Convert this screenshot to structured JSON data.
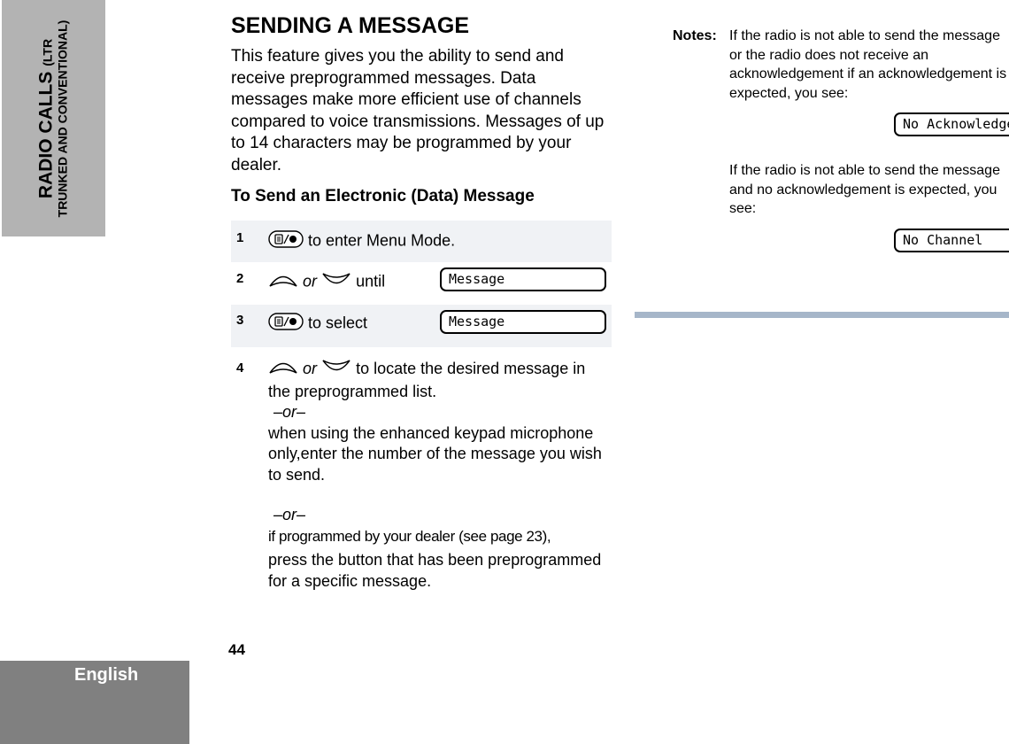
{
  "side_tab": {
    "line1_main": "RADIO CALLS",
    "line1_small": "(LTR",
    "line2": "TRUNKED AND CONVENTIONAL)"
  },
  "language_tab": "English",
  "page_number": "44",
  "section": {
    "title": "SENDING A MESSAGE",
    "intro": "This feature gives you the ability to send and receive preprogrammed messages. Data messages make more efficient use of channels compared to voice transmissions. Messages of up to 14 characters may be programmed by your dealer.",
    "subheading": "To Send an Electronic (Data) Message"
  },
  "steps": [
    {
      "number": "1",
      "icon": "menu-select-button-icon",
      "text": "to enter Menu Mode."
    },
    {
      "number": "2",
      "icons": [
        "up-arrow-icon",
        "down-arrow-icon"
      ],
      "or": "or",
      "text": "until",
      "display": "Message"
    },
    {
      "number": "3",
      "icon": "menu-select-button-icon",
      "text": "to select",
      "display": "Message"
    },
    {
      "number": "4",
      "icons": [
        "up-arrow-icon",
        "down-arrow-icon"
      ],
      "or": "or",
      "text": "to locate the desired message in the preprogrammed list.",
      "or_separator": "–or–",
      "alt1": "when using the enhanced keypad microphone only,enter the number of the message you wish to send.",
      "or_separator2": "–or–",
      "alt2_line1": "if programmed by your dealer (see page 23),",
      "alt2_line2": "press the button that has been preprogrammed for a specific message."
    }
  ],
  "notes": {
    "label": "Notes:",
    "note1": "If the radio is not able to send the message or the radio does not receive an acknowledgement if an acknowledgement is expected, you see:",
    "display1": "No Acknowledge",
    "note2": "If the radio is not able to send the message and no acknowledgement is expected, you see:",
    "display2": "No Channel"
  },
  "colors": {
    "side_tab": "#b3b3b3",
    "language_tab": "#808080",
    "step_shade": "#f0f2f5",
    "rule": "#a6b6c9"
  }
}
